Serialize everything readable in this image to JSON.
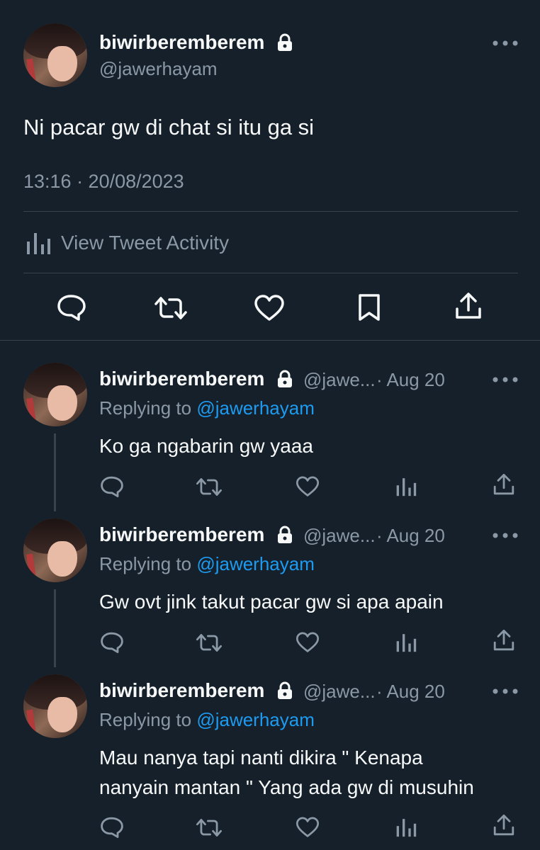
{
  "main_tweet": {
    "display_name": "biwirberemberem",
    "handle": "@jawerhayam",
    "text": "Ni pacar gw di chat si itu ga si",
    "timestamp": "13:16 · 20/08/2023",
    "activity_label": "View Tweet Activity",
    "icons": [
      "reply-icon",
      "retweet-icon",
      "like-icon",
      "bookmark-icon",
      "share-icon"
    ]
  },
  "replies": [
    {
      "display_name": "biwirberemberem",
      "handle_trunc": "@jawe...",
      "date": "· Aug 20",
      "replying_prefix": "Replying to",
      "replying_handle": "@jawerhayam",
      "text": "Ko ga ngabarin gw yaaa"
    },
    {
      "display_name": "biwirberemberem",
      "handle_trunc": "@jawe...",
      "date": "· Aug 20",
      "replying_prefix": "Replying to",
      "replying_handle": "@jawerhayam",
      "text": "Gw ovt jink takut pacar gw si apa apain"
    },
    {
      "display_name": "biwirberemberem",
      "handle_trunc": "@jawe...",
      "date": "· Aug 20",
      "replying_prefix": "Replying to",
      "replying_handle": "@jawerhayam",
      "text_line1": "Mau nanya tapi nanti dikira \" Kenapa",
      "text_line2": "nanyain mantan \" Yang ada gw di musuhin"
    }
  ],
  "colors": {
    "background": "#15202b",
    "text": "#f7f9f9",
    "muted": "#8b98a5",
    "link": "#1d9bf0",
    "divider": "#38444d"
  }
}
